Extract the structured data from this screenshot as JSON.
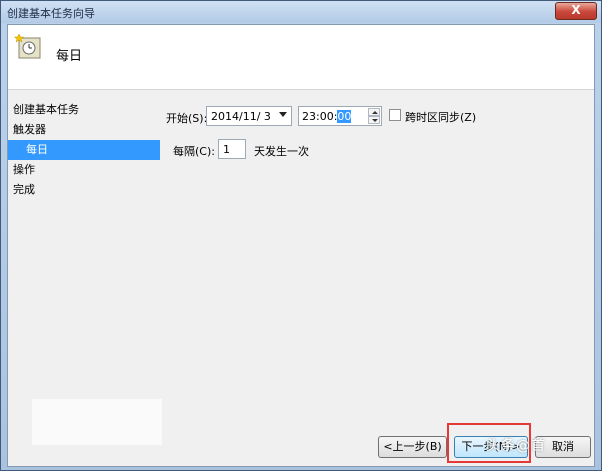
{
  "window": {
    "title": "创建基本任务向导",
    "close_label": "X"
  },
  "header": {
    "icon": "task-clock-icon",
    "title": "每日"
  },
  "steps": [
    {
      "label": "创建基本任务"
    },
    {
      "label": "触发器"
    },
    {
      "label": "每日"
    },
    {
      "label": "操作"
    },
    {
      "label": "完成"
    }
  ],
  "trigger": {
    "start_label": "开始(S):",
    "date_value": "2014/11/ 3",
    "time_prefix": "23:00:",
    "time_selected": "00",
    "sync_label": "跨时区同步(Z)",
    "interval_label": "每隔(C):",
    "interval_value": "1",
    "interval_suffix": "天发生一次"
  },
  "buttons": {
    "back": "<上一步(B)",
    "next": "下一步(N)>",
    "cancel": "取消"
  },
  "watermark": "头条@首"
}
